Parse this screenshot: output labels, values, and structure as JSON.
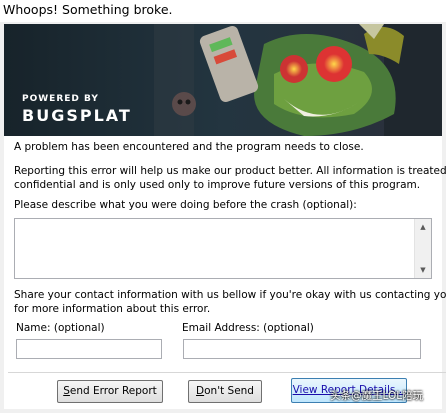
{
  "window": {
    "title": "Whoops! Something broke."
  },
  "banner": {
    "powered_by": "POWERED BY",
    "brand": "BUGSPLAT"
  },
  "messages": {
    "line1": "A problem has been encountered and the program needs to close.",
    "line2": "Reporting this error will help us make our product better. All information is treated as",
    "line3": "confidential and is only used only to improve future versions of this program.",
    "describe_label": "Please describe what you were doing before the crash (optional):",
    "contact1": "Share your contact information with us bellow if you're okay with us contacting you",
    "contact2": "for more information about this error."
  },
  "fields": {
    "name_label": "Name: (optional)",
    "email_label": "Email Address: (optional)",
    "description_value": "",
    "name_value": "",
    "email_value": ""
  },
  "buttons": {
    "send_rest": "end Error Report",
    "send_underline": "S",
    "dont_underline": "D",
    "dont_rest": "on't Send",
    "view_label": "View Report Details..."
  },
  "watermark": "头条@魔王LOL陪玩"
}
